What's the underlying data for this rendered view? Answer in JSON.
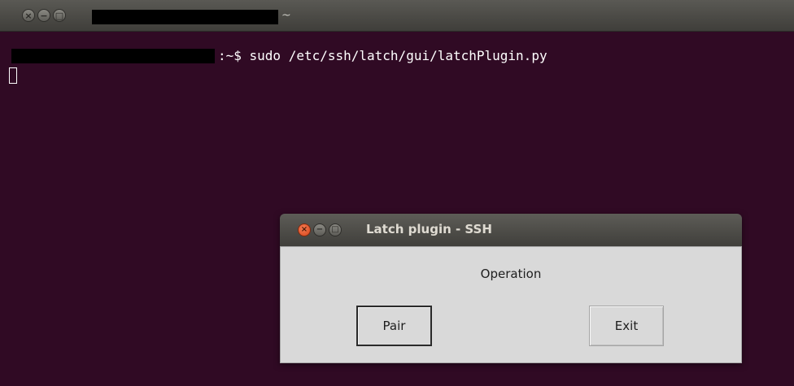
{
  "terminal": {
    "title_suffix": "~",
    "command": ":~$ sudo /etc/ssh/latch/gui/latchPlugin.py",
    "window_buttons": {
      "close_icon": "×",
      "minimize_icon": "−",
      "maximize_icon": "□"
    }
  },
  "dialog": {
    "title": "Latch plugin - SSH",
    "label": "Operation",
    "pair_label": "Pair",
    "exit_label": "Exit",
    "window_buttons": {
      "close_icon": "×",
      "minimize_icon": "−",
      "maximize_icon": "□"
    }
  },
  "colors": {
    "terminal_bg": "#300a24",
    "titlebar": "#4c4b47",
    "dialog_bg": "#d9d9d9",
    "close_button": "#e0562b"
  }
}
